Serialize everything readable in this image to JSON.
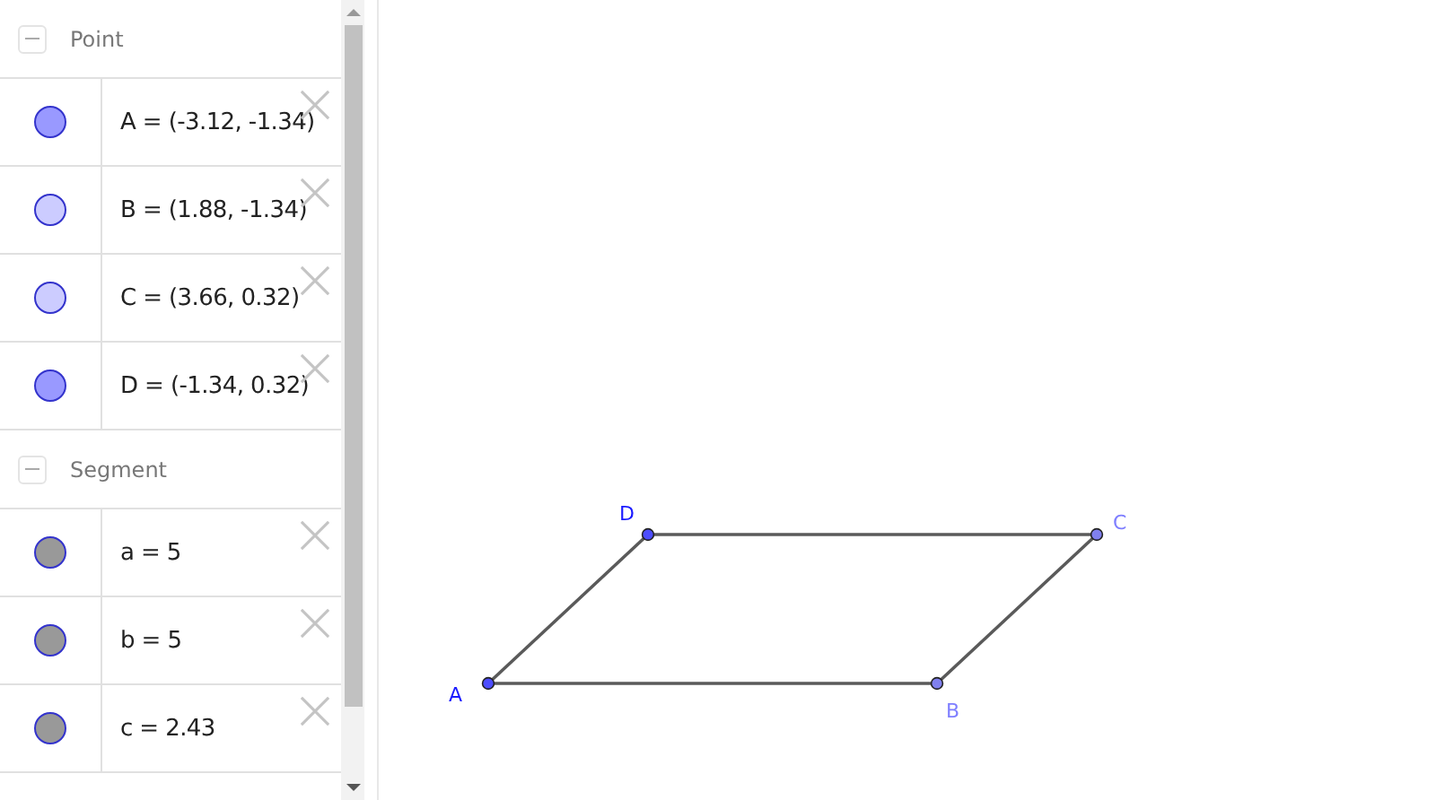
{
  "algebra": {
    "groups": [
      {
        "title": "Point",
        "expanded": true,
        "items": [
          {
            "text": "A = (-3.12, -1.34)",
            "color": "#9999ff"
          },
          {
            "text": "B = (1.88, -1.34)",
            "color": "#ccccff"
          },
          {
            "text": "C = (3.66, 0.32)",
            "color": "#ccccff"
          },
          {
            "text": "D = (-1.34, 0.32)",
            "color": "#9999ff"
          }
        ]
      },
      {
        "title": "Segment",
        "expanded": true,
        "items": [
          {
            "text": "a = 5",
            "color": "#999999"
          },
          {
            "text": "b = 5",
            "color": "#999999"
          },
          {
            "text": "c = 2.43",
            "color": "#999999"
          }
        ]
      }
    ]
  },
  "canvas": {
    "points": [
      {
        "label": "A",
        "color": "#1a1aff"
      },
      {
        "label": "B",
        "color": "#7f7fff"
      },
      {
        "label": "C",
        "color": "#7f7fff"
      },
      {
        "label": "D",
        "color": "#1a1aff"
      }
    ]
  }
}
